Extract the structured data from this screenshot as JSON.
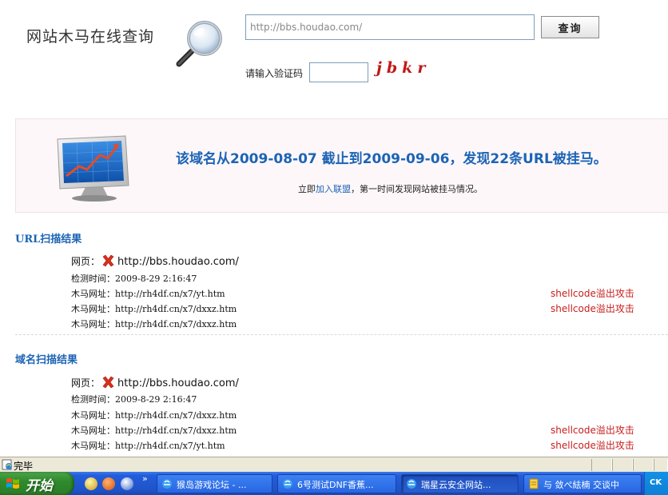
{
  "header": {
    "site_title": "网站木马在线查询",
    "url_value": "http://bbs.houdao.com/",
    "query_button": "查询",
    "captcha_label": "请输入验证码",
    "captcha_text": "jbkr"
  },
  "banner": {
    "headline": "该域名从2009-08-07 截止到2009-09-06，发现22条URL被挂马。",
    "sub_before": "立即",
    "sub_link": "加入联盟",
    "sub_after": "，第一时间发现网站被挂马情况。"
  },
  "url_scan": {
    "title": "URL扫描结果",
    "page_label": "网页：",
    "page_url": "http://bbs.houdao.com/",
    "time_label": "检测时间：",
    "time_value": "2009-8-29 2:16:47",
    "rows": [
      {
        "label": "木马网址：",
        "url": "http://rh4df.cn/x7/yt.htm",
        "attack": "shellcode溢出攻击"
      },
      {
        "label": "木马网址：",
        "url": "http://rh4df.cn/x7/dxxz.htm",
        "attack": "shellcode溢出攻击"
      },
      {
        "label": "木马网址：",
        "url": "http://rh4df.cn/x7/dxxz.htm",
        "attack": ""
      }
    ]
  },
  "domain_scan": {
    "title": "域名扫描结果",
    "page_label": "网页：",
    "page_url": "http://bbs.houdao.com/",
    "time_label": "检测时间：",
    "time_value": "2009-8-29 2:16:47",
    "rows": [
      {
        "label": "木马网址：",
        "url": "http://rh4df.cn/x7/dxxz.htm",
        "attack": ""
      },
      {
        "label": "木马网址：",
        "url": "http://rh4df.cn/x7/dxxz.htm",
        "attack": "shellcode溢出攻击"
      },
      {
        "label": "木马网址：",
        "url": "http://rh4df.cn/x7/yt.htm",
        "attack": "shellcode溢出攻击"
      }
    ]
  },
  "statusbar": {
    "text": "完毕"
  },
  "taskbar": {
    "start_label": "开始",
    "chevron": "»",
    "tasks": [
      {
        "label": "猴岛游戏论坛 - ..."
      },
      {
        "label": "6号测试DNF香蕉..."
      },
      {
        "label": "瑞星云安全网站..."
      },
      {
        "label": "与 敛ぺ紶楠 交谈中"
      }
    ],
    "tray_label": "CK"
  },
  "colors": {
    "accent_blue": "#1c64b4",
    "attack_red": "#c81e1e",
    "banner_bg": "#fdf7fa",
    "taskbar_blue": "#245edb",
    "start_green": "#2f8b2d"
  }
}
